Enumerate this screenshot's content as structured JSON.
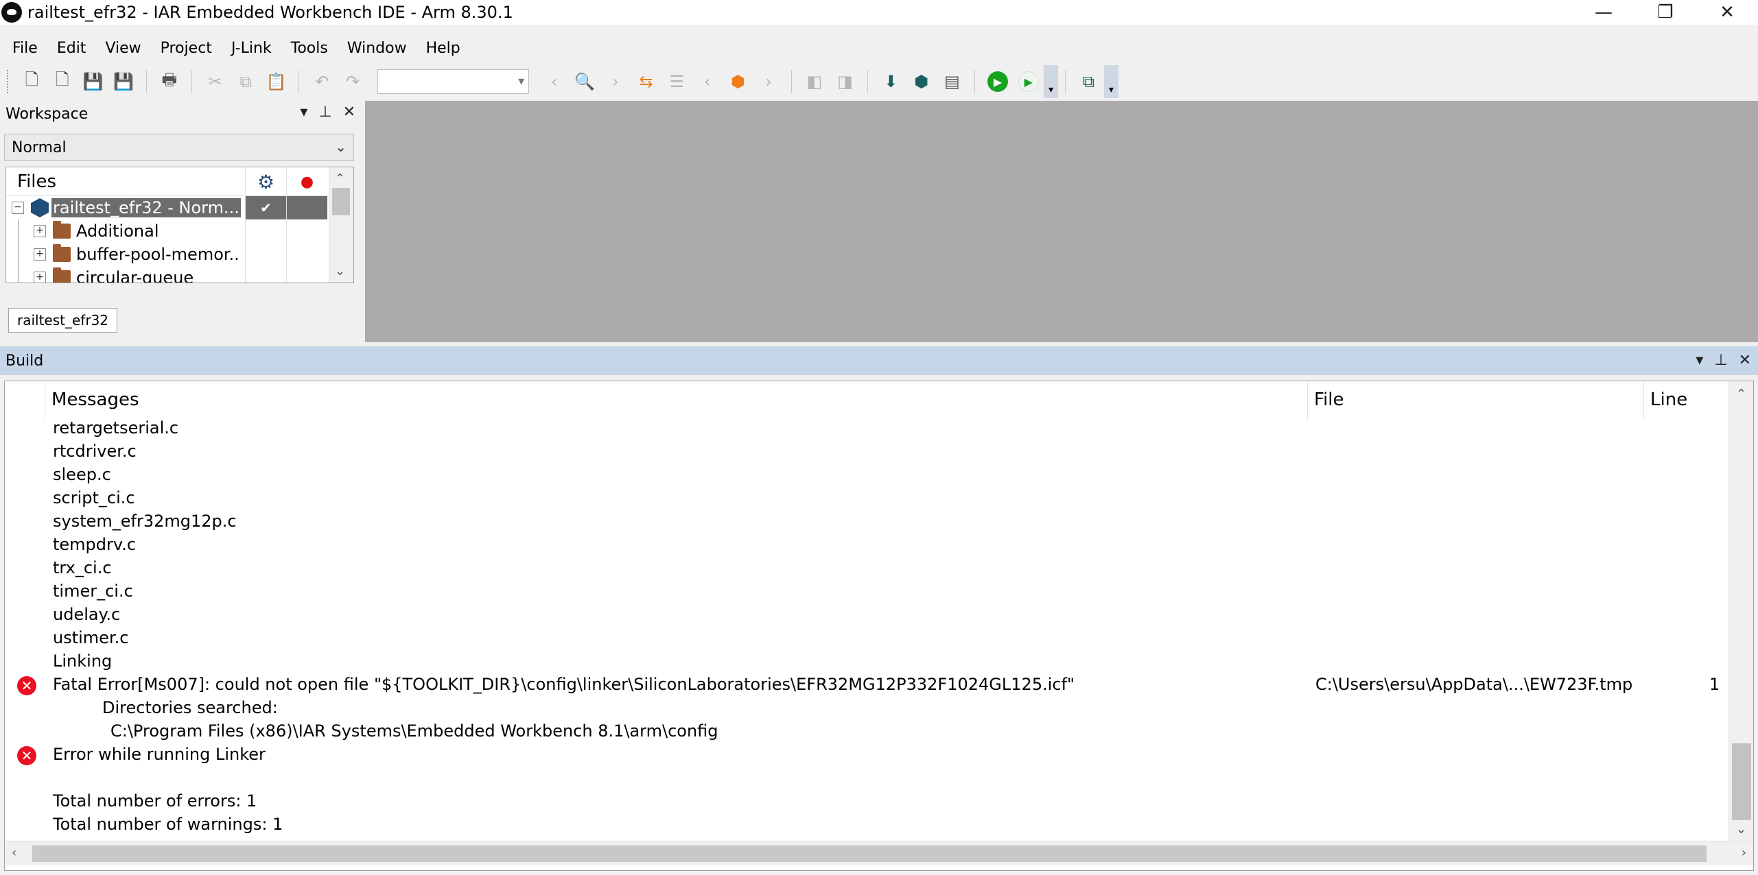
{
  "window": {
    "title": "railtest_efr32 - IAR Embedded Workbench IDE - Arm 8.30.1",
    "minimize": "—",
    "maximize": "❐",
    "close": "✕"
  },
  "menu": [
    "File",
    "Edit",
    "View",
    "Project",
    "J-Link",
    "Tools",
    "Window",
    "Help"
  ],
  "toolbar": {
    "search_combo_value": ""
  },
  "workspace": {
    "title": "Workspace",
    "configuration": "Normal",
    "files_header": "Files",
    "tree": [
      {
        "label": "railtest_efr32 - Norm...",
        "type": "project",
        "selected": true,
        "checked": true
      },
      {
        "label": "Additional",
        "type": "folder"
      },
      {
        "label": "buffer-pool-memor...",
        "type": "folder"
      },
      {
        "label": "circular-queue",
        "type": "folder"
      }
    ],
    "tab": "railtest_efr32"
  },
  "build": {
    "title": "Build",
    "columns": {
      "messages": "Messages",
      "file": "File",
      "line": "Line"
    },
    "rows": [
      {
        "text": "retargetserial.c"
      },
      {
        "text": "rtcdriver.c"
      },
      {
        "text": "sleep.c"
      },
      {
        "text": "script_ci.c"
      },
      {
        "text": "system_efr32mg12p.c"
      },
      {
        "text": "tempdrv.c"
      },
      {
        "text": "trx_ci.c"
      },
      {
        "text": "timer_ci.c"
      },
      {
        "text": "udelay.c"
      },
      {
        "text": "ustimer.c"
      },
      {
        "text": "Linking"
      },
      {
        "text": "Fatal Error[Ms007]: could not open file \"${TOOLKIT_DIR}\\config\\linker\\SiliconLaboratories\\EFR32MG12P332F1024GL125.icf\"",
        "error": true,
        "file": "C:\\Users\\ersu\\AppData\\...\\EW723F.tmp",
        "line": "1"
      },
      {
        "text": "Directories searched:",
        "indent": 1
      },
      {
        "text": "C:\\Program Files (x86)\\IAR Systems\\Embedded Workbench 8.1\\arm\\config",
        "indent": 2
      },
      {
        "text": "Error while running Linker",
        "error": true
      },
      {
        "text": ""
      },
      {
        "text": "Total number of errors: 1"
      },
      {
        "text": "Total number of warnings: 1"
      }
    ]
  }
}
